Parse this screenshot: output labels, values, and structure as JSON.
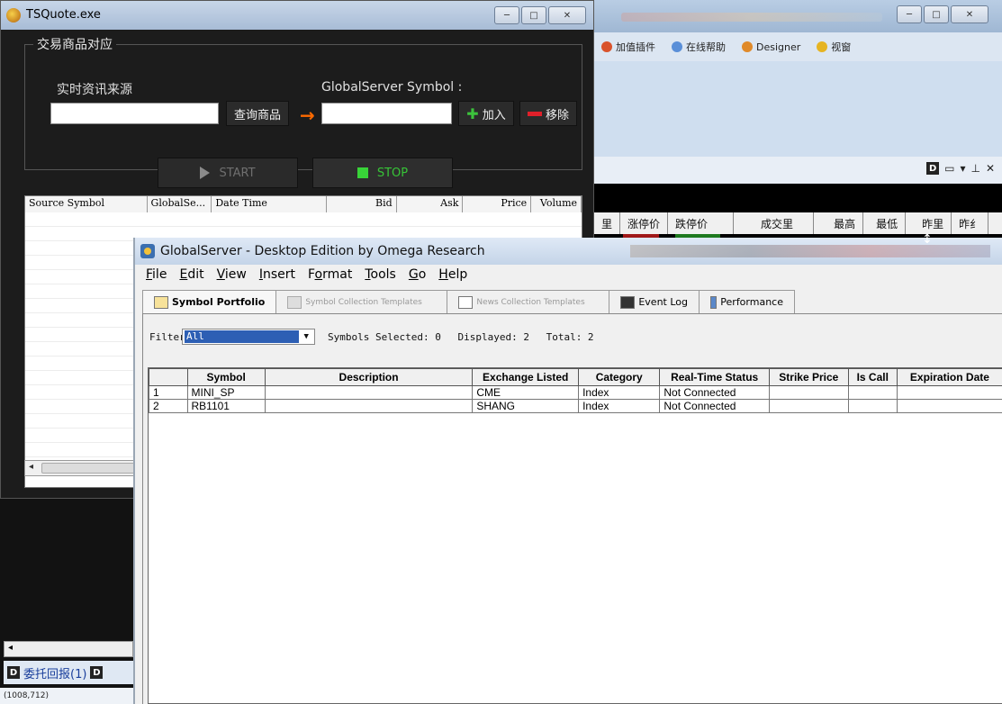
{
  "background_app": {
    "menu": [
      {
        "label": "加值插件",
        "icon": "plugin-icon",
        "color": "#d9532c"
      },
      {
        "label": "在线帮助",
        "icon": "help-icon",
        "color": "#5a8fd8"
      },
      {
        "label": "Designer",
        "icon": "designer-icon",
        "color": "#e08a2a"
      },
      {
        "label": "视窗",
        "icon": "window-icon",
        "color": "#e6b422"
      }
    ],
    "quote_columns": [
      "里",
      "涨停价",
      "跌停价",
      "成交里",
      "最高",
      "最低",
      "昨里",
      "昨纟"
    ]
  },
  "tsquote": {
    "title": "TSQuote.exe",
    "group_title": "交易商品对应",
    "source_label": "实时资讯来源",
    "source_value": "",
    "query_button": "查询商品",
    "gs_symbol_label": "GlobalServer Symbol :",
    "gs_symbol_value": "",
    "add_button": "加入",
    "remove_button": "移除",
    "start_button": "START",
    "stop_button": "STOP",
    "grid_columns": [
      "Source Symbol",
      "GlobalSe...",
      "Date Time",
      "Bid",
      "Ask",
      "Price",
      "Volume"
    ],
    "bottom_tab": "委托回报(1)",
    "coords": "(1008,712)"
  },
  "globalserver": {
    "title": "GlobalServer - Desktop Edition by Omega Research",
    "menu": [
      "File",
      "Edit",
      "View",
      "Insert",
      "Format",
      "Tools",
      "Go",
      "Help"
    ],
    "tabs": [
      {
        "label": "Symbol Portfolio",
        "state": "active"
      },
      {
        "label": "Symbol Collection Templates",
        "state": "disabled"
      },
      {
        "label": "News Collection Templates",
        "state": "disabled"
      },
      {
        "label": "Event Log",
        "state": "normal"
      },
      {
        "label": "Performance",
        "state": "normal"
      }
    ],
    "filter_label": "Filter",
    "filter_value": "All",
    "symbols_selected": "Symbols Selected: 0",
    "displayed": "Displayed: 2",
    "total": "Total: 2",
    "columns": [
      "",
      "Symbol",
      "Description",
      "Exchange Listed",
      "Category",
      "Real-Time Status",
      "Strike Price",
      "Is Call",
      "Expiration Date"
    ],
    "rows": [
      [
        "1",
        "MINI_SP",
        "",
        "CME",
        "Index",
        "Not Connected",
        "",
        "",
        ""
      ],
      [
        "2",
        "RB1101",
        "",
        "SHANG",
        "Index",
        "Not Connected",
        "",
        "",
        ""
      ]
    ]
  }
}
